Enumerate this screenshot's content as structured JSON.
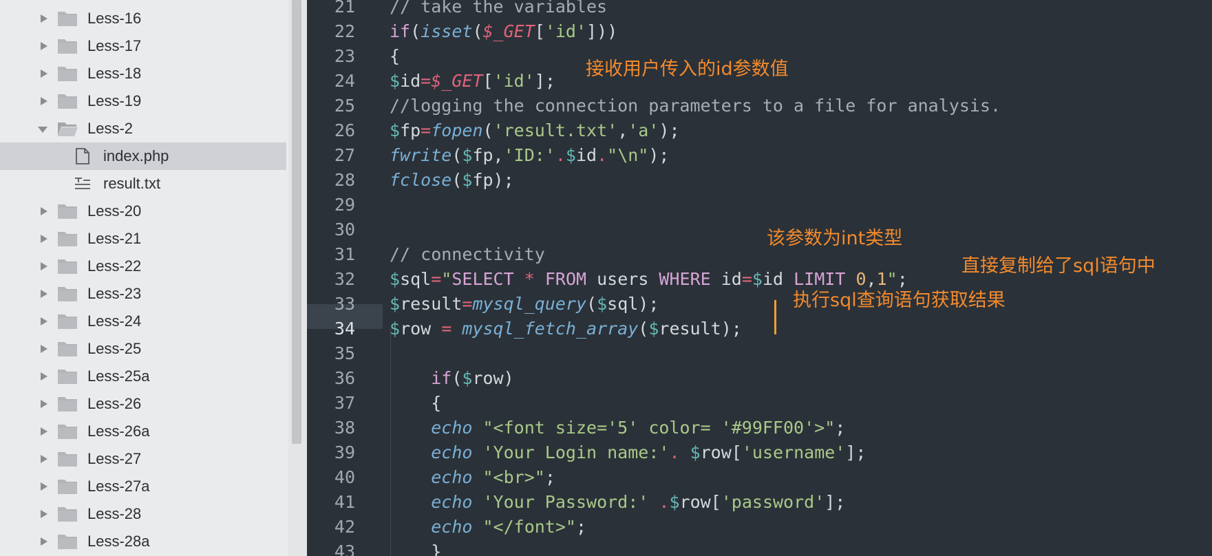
{
  "sidebar": {
    "items": [
      {
        "label": "Less-16",
        "type": "folder",
        "state": "collapsed"
      },
      {
        "label": "Less-17",
        "type": "folder",
        "state": "collapsed"
      },
      {
        "label": "Less-18",
        "type": "folder",
        "state": "collapsed"
      },
      {
        "label": "Less-19",
        "type": "folder",
        "state": "collapsed"
      },
      {
        "label": "Less-2",
        "type": "folder",
        "state": "expanded"
      },
      {
        "label": "index.php",
        "type": "file",
        "selected": true
      },
      {
        "label": "result.txt",
        "type": "file"
      },
      {
        "label": "Less-20",
        "type": "folder",
        "state": "collapsed"
      },
      {
        "label": "Less-21",
        "type": "folder",
        "state": "collapsed"
      },
      {
        "label": "Less-22",
        "type": "folder",
        "state": "collapsed"
      },
      {
        "label": "Less-23",
        "type": "folder",
        "state": "collapsed"
      },
      {
        "label": "Less-24",
        "type": "folder",
        "state": "collapsed"
      },
      {
        "label": "Less-25",
        "type": "folder",
        "state": "collapsed"
      },
      {
        "label": "Less-25a",
        "type": "folder",
        "state": "collapsed"
      },
      {
        "label": "Less-26",
        "type": "folder",
        "state": "collapsed"
      },
      {
        "label": "Less-26a",
        "type": "folder",
        "state": "collapsed"
      },
      {
        "label": "Less-27",
        "type": "folder",
        "state": "collapsed"
      },
      {
        "label": "Less-27a",
        "type": "folder",
        "state": "collapsed"
      },
      {
        "label": "Less-28",
        "type": "folder",
        "state": "collapsed"
      },
      {
        "label": "Less-28a",
        "type": "folder",
        "state": "collapsed"
      }
    ]
  },
  "editor": {
    "current_line": "34",
    "lines": [
      {
        "n": "21",
        "tokens": [
          [
            "cm",
            "// take the variables"
          ]
        ]
      },
      {
        "n": "22",
        "tokens": [
          [
            "kw",
            "if"
          ],
          [
            "plain",
            "("
          ],
          [
            "fn",
            "isset"
          ],
          [
            "plain",
            "("
          ],
          [
            "sup",
            "$_GET"
          ],
          [
            "plain",
            "["
          ],
          [
            "str",
            "'id'"
          ],
          [
            "plain",
            "]))"
          ]
        ]
      },
      {
        "n": "23",
        "tokens": [
          [
            "plain",
            "{"
          ]
        ]
      },
      {
        "n": "24",
        "tokens": [
          [
            "var",
            "$"
          ],
          [
            "plain",
            "id"
          ],
          [
            "op",
            "="
          ],
          [
            "sup",
            "$_GET"
          ],
          [
            "plain",
            "["
          ],
          [
            "str",
            "'id'"
          ],
          [
            "plain",
            "];"
          ]
        ]
      },
      {
        "n": "25",
        "tokens": [
          [
            "cm",
            "//logging the connection parameters to a file for analysis."
          ]
        ]
      },
      {
        "n": "26",
        "tokens": [
          [
            "var",
            "$"
          ],
          [
            "plain",
            "fp"
          ],
          [
            "op",
            "="
          ],
          [
            "fn",
            "fopen"
          ],
          [
            "plain",
            "("
          ],
          [
            "str",
            "'result.txt'"
          ],
          [
            "plain",
            ","
          ],
          [
            "str",
            "'a'"
          ],
          [
            "plain",
            ");"
          ]
        ]
      },
      {
        "n": "27",
        "tokens": [
          [
            "fn",
            "fwrite"
          ],
          [
            "plain",
            "("
          ],
          [
            "var",
            "$"
          ],
          [
            "plain",
            "fp,"
          ],
          [
            "str",
            "'ID:'"
          ],
          [
            "op",
            "."
          ],
          [
            "var",
            "$"
          ],
          [
            "plain",
            "id"
          ],
          [
            "op",
            "."
          ],
          [
            "str",
            "\"\\n\""
          ],
          [
            "plain",
            ");"
          ]
        ]
      },
      {
        "n": "28",
        "tokens": [
          [
            "fn",
            "fclose"
          ],
          [
            "plain",
            "("
          ],
          [
            "var",
            "$"
          ],
          [
            "plain",
            "fp);"
          ]
        ]
      },
      {
        "n": "29",
        "tokens": []
      },
      {
        "n": "30",
        "tokens": []
      },
      {
        "n": "31",
        "tokens": [
          [
            "cm",
            "// connectivity"
          ]
        ]
      },
      {
        "n": "32",
        "tokens": [
          [
            "var",
            "$"
          ],
          [
            "plain",
            "sql"
          ],
          [
            "op",
            "="
          ],
          [
            "str",
            "\""
          ],
          [
            "kw",
            "SELECT"
          ],
          [
            "str",
            " "
          ],
          [
            "op",
            "*"
          ],
          [
            "str",
            " "
          ],
          [
            "kw",
            "FROM"
          ],
          [
            "plain",
            " users "
          ],
          [
            "kw",
            "WHERE"
          ],
          [
            "plain",
            " id"
          ],
          [
            "op",
            "="
          ],
          [
            "var",
            "$"
          ],
          [
            "plain",
            "id "
          ],
          [
            "kw",
            "LIMIT"
          ],
          [
            "str",
            " "
          ],
          [
            "num",
            "0"
          ],
          [
            "plain",
            ","
          ],
          [
            "num",
            "1"
          ],
          [
            "str",
            "\""
          ],
          [
            "plain",
            ";"
          ]
        ]
      },
      {
        "n": "33",
        "tokens": [
          [
            "var",
            "$"
          ],
          [
            "plain",
            "result"
          ],
          [
            "op",
            "="
          ],
          [
            "fn",
            "mysql_query"
          ],
          [
            "plain",
            "("
          ],
          [
            "var",
            "$"
          ],
          [
            "plain",
            "sql);"
          ]
        ]
      },
      {
        "n": "34",
        "tokens": [
          [
            "var",
            "$"
          ],
          [
            "plain",
            "row "
          ],
          [
            "op",
            "="
          ],
          [
            "plain",
            " "
          ],
          [
            "fn",
            "mysql_fetch_array"
          ],
          [
            "plain",
            "("
          ],
          [
            "var",
            "$"
          ],
          [
            "plain",
            "result);"
          ]
        ]
      },
      {
        "n": "35",
        "tokens": []
      },
      {
        "n": "36",
        "tokens": [
          [
            "plain",
            "    "
          ],
          [
            "kw",
            "if"
          ],
          [
            "plain",
            "("
          ],
          [
            "var",
            "$"
          ],
          [
            "plain",
            "row)"
          ]
        ]
      },
      {
        "n": "37",
        "tokens": [
          [
            "plain",
            "    {"
          ]
        ]
      },
      {
        "n": "38",
        "tokens": [
          [
            "plain",
            "    "
          ],
          [
            "fn",
            "echo"
          ],
          [
            "plain",
            " "
          ],
          [
            "str",
            "\"<font size='5' color= '#99FF00'>\""
          ],
          [
            "plain",
            ";"
          ]
        ]
      },
      {
        "n": "39",
        "tokens": [
          [
            "plain",
            "    "
          ],
          [
            "fn",
            "echo"
          ],
          [
            "plain",
            " "
          ],
          [
            "str",
            "'Your Login name:'"
          ],
          [
            "op",
            "."
          ],
          [
            "plain",
            " "
          ],
          [
            "var",
            "$"
          ],
          [
            "plain",
            "row["
          ],
          [
            "str",
            "'username'"
          ],
          [
            "plain",
            "];"
          ]
        ]
      },
      {
        "n": "40",
        "tokens": [
          [
            "plain",
            "    "
          ],
          [
            "fn",
            "echo"
          ],
          [
            "plain",
            " "
          ],
          [
            "str",
            "\"<br>\""
          ],
          [
            "plain",
            ";"
          ]
        ]
      },
      {
        "n": "41",
        "tokens": [
          [
            "plain",
            "    "
          ],
          [
            "fn",
            "echo"
          ],
          [
            "plain",
            " "
          ],
          [
            "str",
            "'Your Password:'"
          ],
          [
            "plain",
            " "
          ],
          [
            "op",
            "."
          ],
          [
            "var",
            "$"
          ],
          [
            "plain",
            "row["
          ],
          [
            "str",
            "'password'"
          ],
          [
            "plain",
            "];"
          ]
        ]
      },
      {
        "n": "42",
        "tokens": [
          [
            "plain",
            "    "
          ],
          [
            "fn",
            "echo"
          ],
          [
            "plain",
            " "
          ],
          [
            "str",
            "\"</font>\""
          ],
          [
            "plain",
            ";"
          ]
        ]
      },
      {
        "n": "43",
        "tokens": [
          [
            "plain",
            "    }"
          ]
        ]
      }
    ]
  },
  "annotations": {
    "receive_id": "接收用户传入的id参数值",
    "int_type": "该参数为int类型",
    "copy_to_sql": "直接复制给了sql语句中",
    "execute_query": "执行sql查询语句获取结果"
  },
  "colors": {
    "annotation": "#f28a2d",
    "editor_bg": "#2b3138",
    "sidebar_bg": "#eaebed",
    "selected_row": "#cfd1d6"
  }
}
